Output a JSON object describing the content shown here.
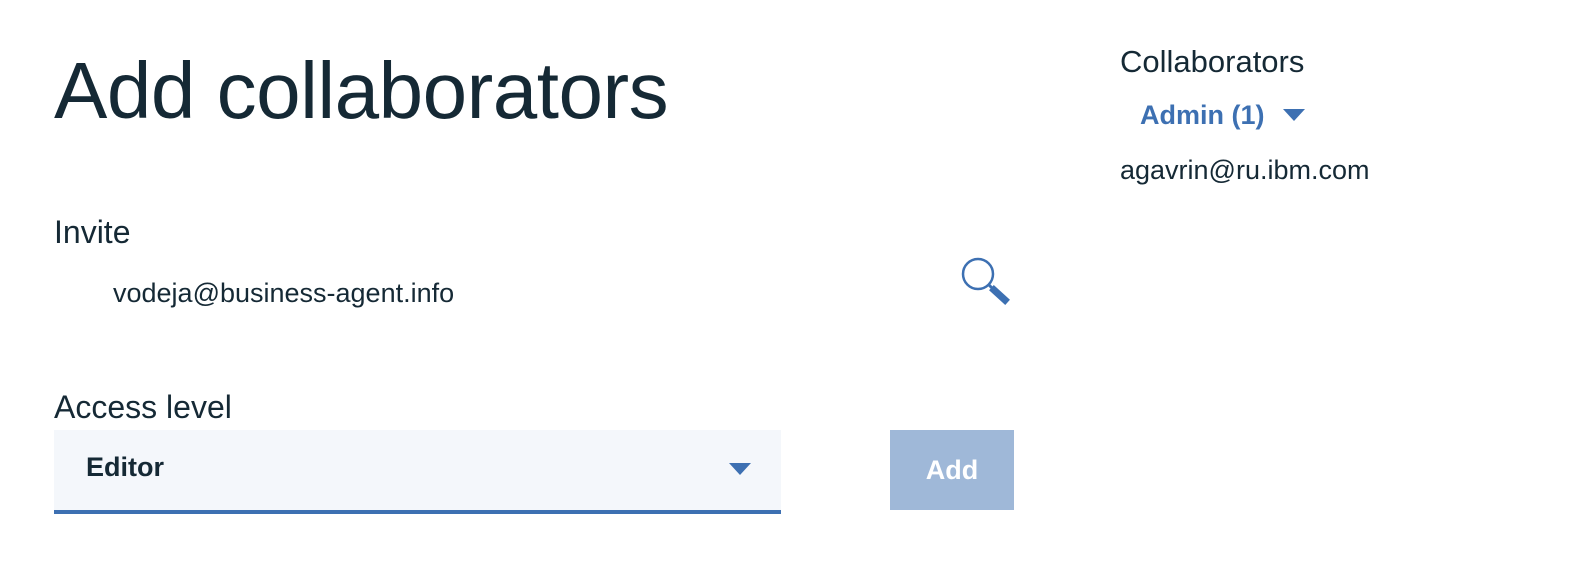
{
  "title": "Add collaborators",
  "invite": {
    "label": "Invite",
    "value": "vodeja@business-agent.info",
    "icon": "search-icon"
  },
  "access_level": {
    "label": "Access level",
    "selected": "Editor",
    "icon": "chevron-down-icon"
  },
  "add_button": {
    "label": "Add",
    "enabled": false
  },
  "collaborators": {
    "title": "Collaborators",
    "filter_label": "Admin (1)",
    "members": [
      "agavrin@ru.ibm.com"
    ]
  },
  "colors": {
    "text": "#152935",
    "accent": "#3d70b2",
    "select_bg": "#f4f7fb",
    "button_disabled": "#9fb8d8"
  }
}
